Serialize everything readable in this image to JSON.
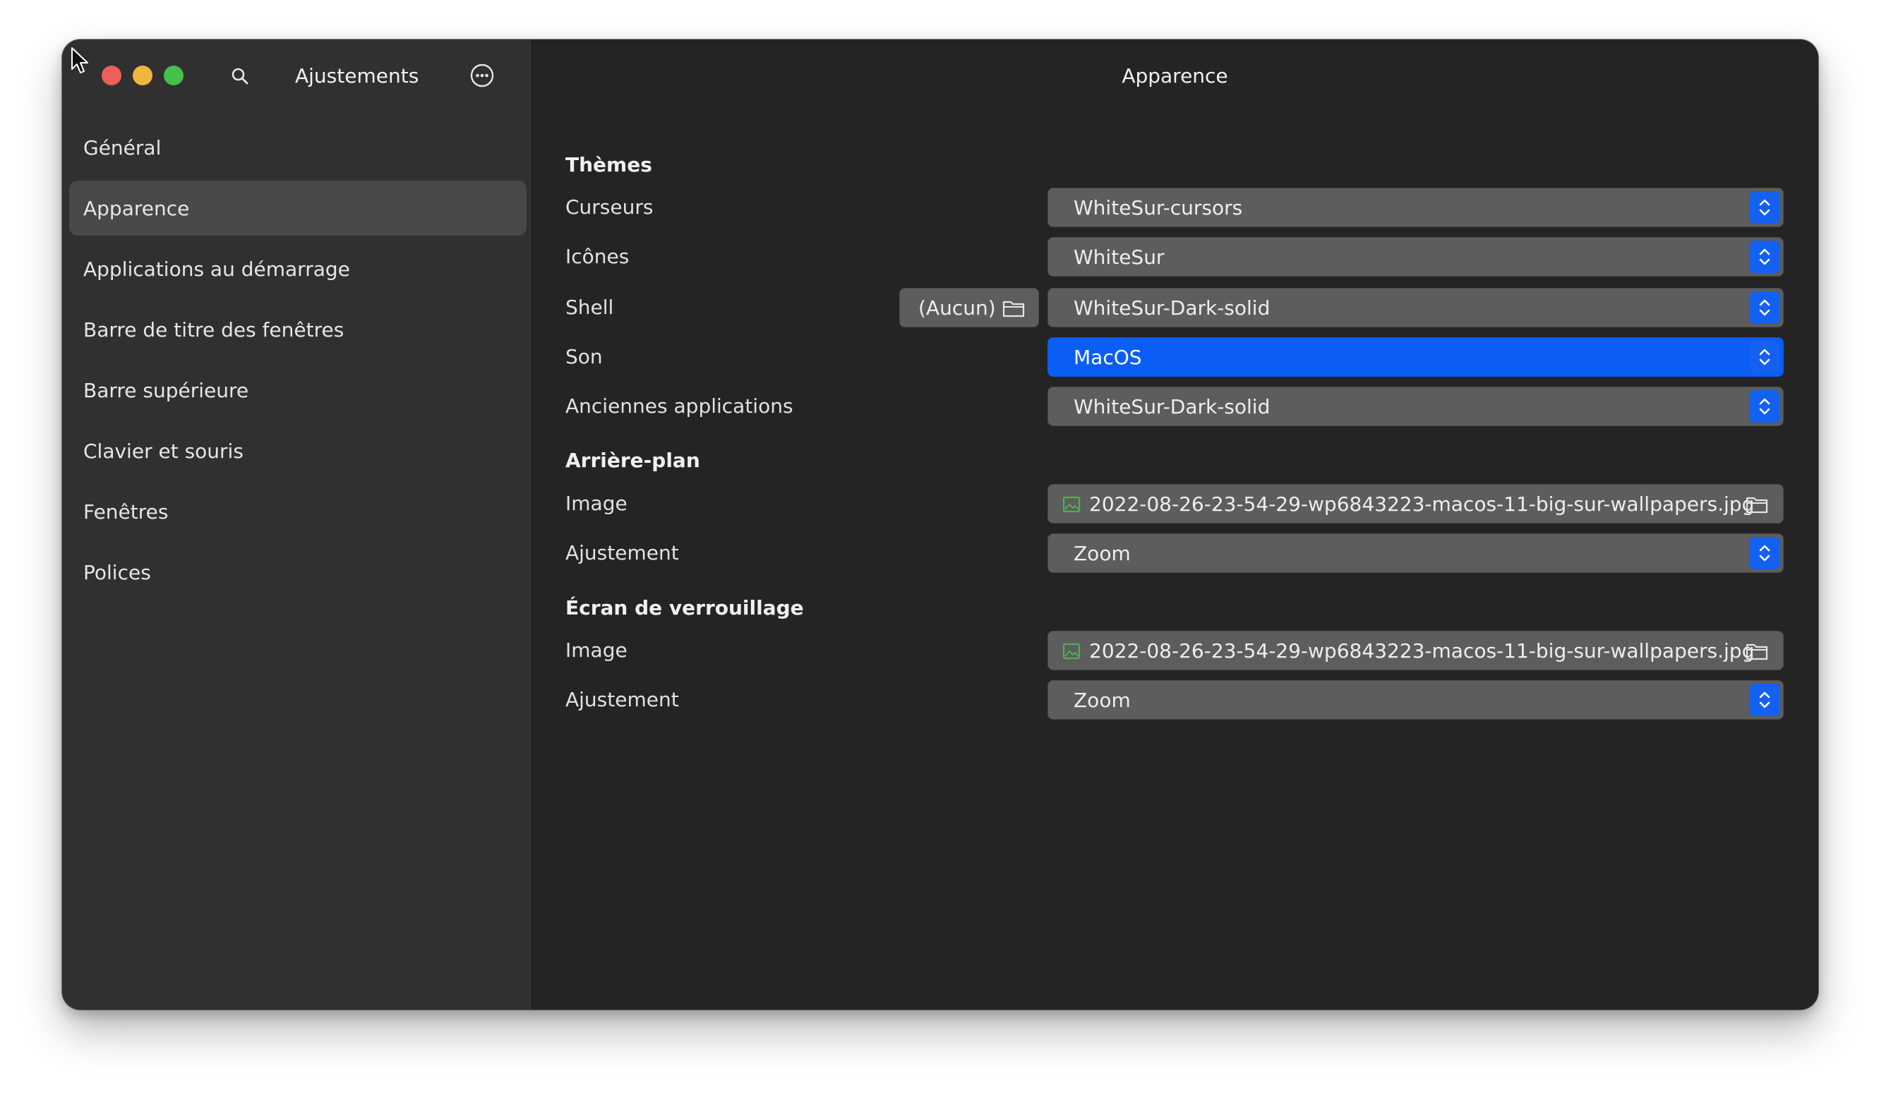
{
  "sidebar": {
    "title": "Ajustements",
    "items": [
      {
        "label": "Général",
        "active": false
      },
      {
        "label": "Apparence",
        "active": true
      },
      {
        "label": "Applications au démarrage",
        "active": false
      },
      {
        "label": "Barre de titre des fenêtres",
        "active": false
      },
      {
        "label": "Barre supérieure",
        "active": false
      },
      {
        "label": "Clavier et souris",
        "active": false
      },
      {
        "label": "Fenêtres",
        "active": false
      },
      {
        "label": "Polices",
        "active": false
      }
    ]
  },
  "content": {
    "title": "Apparence",
    "themes": {
      "heading": "Thèmes",
      "cursors": {
        "label": "Curseurs",
        "value": "WhiteSur-cursors"
      },
      "icons": {
        "label": "Icônes",
        "value": "WhiteSur"
      },
      "shell": {
        "label": "Shell",
        "none_label": "(Aucun)",
        "value": "WhiteSur-Dark-solid"
      },
      "sound": {
        "label": "Son",
        "value": "MacOS"
      },
      "legacy": {
        "label": "Anciennes applications",
        "value": "WhiteSur-Dark-solid"
      }
    },
    "background": {
      "heading": "Arrière-plan",
      "image": {
        "label": "Image",
        "value": "2022-08-26-23-54-29-wp6843223-macos-11-big-sur-wallpapers.jpg"
      },
      "adjustment": {
        "label": "Ajustement",
        "value": "Zoom"
      }
    },
    "lockscreen": {
      "heading": "Écran de verrouillage",
      "image": {
        "label": "Image",
        "value": "2022-08-26-23-54-29-wp6843223-macos-11-big-sur-wallpapers.jpg"
      },
      "adjustment": {
        "label": "Ajustement",
        "value": "Zoom"
      }
    }
  },
  "icons": {
    "close": "close-traffic-light",
    "minimize": "minimize-traffic-light",
    "maximize": "maximize-traffic-light",
    "search": "search-icon",
    "menu": "more-options-icon",
    "folder": "folder-icon",
    "image": "image-file-icon",
    "combo": "chevron-up-down-icon",
    "cursor": "mouse-pointer-icon"
  },
  "colors": {
    "window_bg": "#242424",
    "sidebar_bg": "#303030",
    "selected_row": "#484848",
    "accent": "#0b5ef5",
    "combo_bg": "#5d5d5d",
    "close": "#ed5f57",
    "minimize": "#f0b63c",
    "maximize": "#45c04a",
    "image_icon": "#49b34d"
  }
}
